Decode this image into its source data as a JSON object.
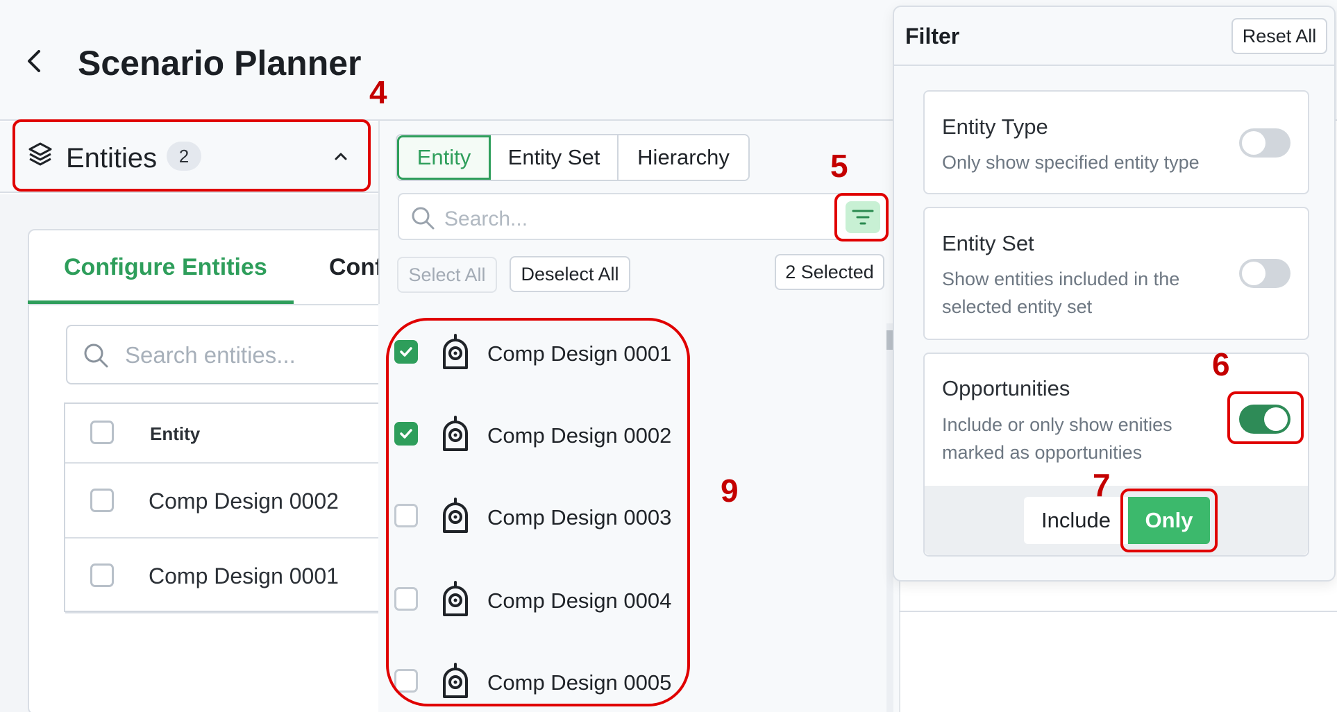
{
  "header": {
    "title": "Scenario Planner"
  },
  "entities_bar": {
    "label": "Entities",
    "count": "2"
  },
  "left": {
    "tabs": [
      "Configure Entities",
      "Conf"
    ],
    "search_placeholder": "Search entities...",
    "table_header": "Entity",
    "rows": [
      "Comp Design 0002",
      "Comp Design 0001"
    ]
  },
  "picker": {
    "modes": [
      "Entity",
      "Entity Set",
      "Hierarchy"
    ],
    "active_mode": "Entity",
    "search_placeholder": "Search...",
    "select_all": "Select All",
    "deselect_all": "Deselect All",
    "selected": "2 Selected",
    "items": [
      {
        "label": "Comp Design 0001",
        "checked": true
      },
      {
        "label": "Comp Design 0002",
        "checked": true
      },
      {
        "label": "Comp Design 0003",
        "checked": false
      },
      {
        "label": "Comp Design 0004",
        "checked": false
      },
      {
        "label": "Comp Design 0005",
        "checked": false
      }
    ]
  },
  "filter": {
    "title": "Filter",
    "reset": "Reset All",
    "entity_type": {
      "title": "Entity Type",
      "desc": "Only show specified entity type",
      "on": false
    },
    "entity_set": {
      "title": "Entity Set",
      "desc": "Show entities included in the selected entity set",
      "on": false
    },
    "opportunities": {
      "title": "Opportunities",
      "desc": "Include or only show enities marked as opportunities",
      "on": true
    },
    "include": "Include",
    "only": "Only"
  },
  "annotations": [
    "4",
    "5",
    "6",
    "7",
    "9"
  ],
  "colors": {
    "accent": "#2e9e5b",
    "annotation": "#e00000",
    "only_button": "#3cb96c"
  }
}
